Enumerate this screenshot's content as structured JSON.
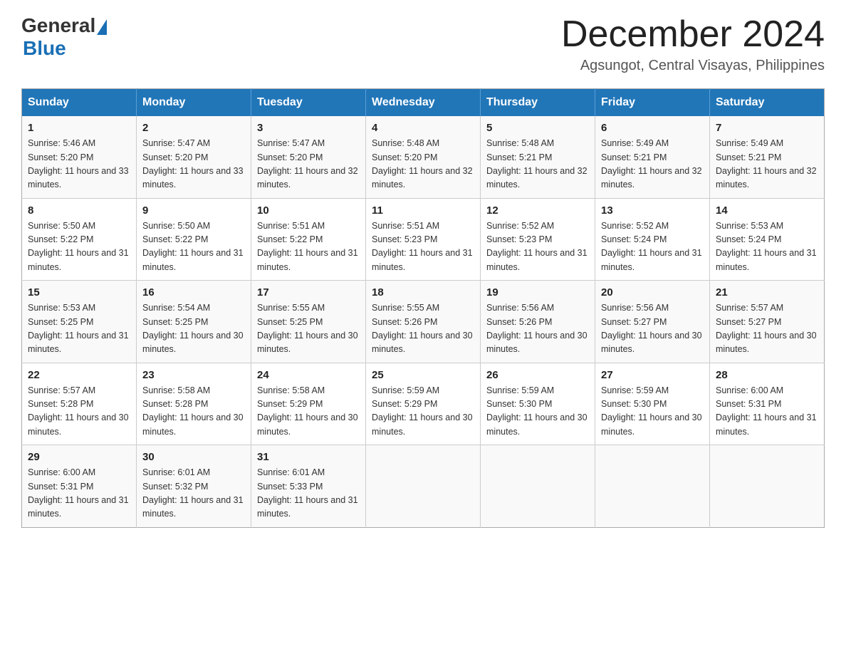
{
  "header": {
    "logo_general": "General",
    "logo_blue": "Blue",
    "month_title": "December 2024",
    "location": "Agsungot, Central Visayas, Philippines"
  },
  "columns": [
    "Sunday",
    "Monday",
    "Tuesday",
    "Wednesday",
    "Thursday",
    "Friday",
    "Saturday"
  ],
  "weeks": [
    [
      {
        "day": "1",
        "sunrise": "5:46 AM",
        "sunset": "5:20 PM",
        "daylight": "11 hours and 33 minutes."
      },
      {
        "day": "2",
        "sunrise": "5:47 AM",
        "sunset": "5:20 PM",
        "daylight": "11 hours and 33 minutes."
      },
      {
        "day": "3",
        "sunrise": "5:47 AM",
        "sunset": "5:20 PM",
        "daylight": "11 hours and 32 minutes."
      },
      {
        "day": "4",
        "sunrise": "5:48 AM",
        "sunset": "5:20 PM",
        "daylight": "11 hours and 32 minutes."
      },
      {
        "day": "5",
        "sunrise": "5:48 AM",
        "sunset": "5:21 PM",
        "daylight": "11 hours and 32 minutes."
      },
      {
        "day": "6",
        "sunrise": "5:49 AM",
        "sunset": "5:21 PM",
        "daylight": "11 hours and 32 minutes."
      },
      {
        "day": "7",
        "sunrise": "5:49 AM",
        "sunset": "5:21 PM",
        "daylight": "11 hours and 32 minutes."
      }
    ],
    [
      {
        "day": "8",
        "sunrise": "5:50 AM",
        "sunset": "5:22 PM",
        "daylight": "11 hours and 31 minutes."
      },
      {
        "day": "9",
        "sunrise": "5:50 AM",
        "sunset": "5:22 PM",
        "daylight": "11 hours and 31 minutes."
      },
      {
        "day": "10",
        "sunrise": "5:51 AM",
        "sunset": "5:22 PM",
        "daylight": "11 hours and 31 minutes."
      },
      {
        "day": "11",
        "sunrise": "5:51 AM",
        "sunset": "5:23 PM",
        "daylight": "11 hours and 31 minutes."
      },
      {
        "day": "12",
        "sunrise": "5:52 AM",
        "sunset": "5:23 PM",
        "daylight": "11 hours and 31 minutes."
      },
      {
        "day": "13",
        "sunrise": "5:52 AM",
        "sunset": "5:24 PM",
        "daylight": "11 hours and 31 minutes."
      },
      {
        "day": "14",
        "sunrise": "5:53 AM",
        "sunset": "5:24 PM",
        "daylight": "11 hours and 31 minutes."
      }
    ],
    [
      {
        "day": "15",
        "sunrise": "5:53 AM",
        "sunset": "5:25 PM",
        "daylight": "11 hours and 31 minutes."
      },
      {
        "day": "16",
        "sunrise": "5:54 AM",
        "sunset": "5:25 PM",
        "daylight": "11 hours and 30 minutes."
      },
      {
        "day": "17",
        "sunrise": "5:55 AM",
        "sunset": "5:25 PM",
        "daylight": "11 hours and 30 minutes."
      },
      {
        "day": "18",
        "sunrise": "5:55 AM",
        "sunset": "5:26 PM",
        "daylight": "11 hours and 30 minutes."
      },
      {
        "day": "19",
        "sunrise": "5:56 AM",
        "sunset": "5:26 PM",
        "daylight": "11 hours and 30 minutes."
      },
      {
        "day": "20",
        "sunrise": "5:56 AM",
        "sunset": "5:27 PM",
        "daylight": "11 hours and 30 minutes."
      },
      {
        "day": "21",
        "sunrise": "5:57 AM",
        "sunset": "5:27 PM",
        "daylight": "11 hours and 30 minutes."
      }
    ],
    [
      {
        "day": "22",
        "sunrise": "5:57 AM",
        "sunset": "5:28 PM",
        "daylight": "11 hours and 30 minutes."
      },
      {
        "day": "23",
        "sunrise": "5:58 AM",
        "sunset": "5:28 PM",
        "daylight": "11 hours and 30 minutes."
      },
      {
        "day": "24",
        "sunrise": "5:58 AM",
        "sunset": "5:29 PM",
        "daylight": "11 hours and 30 minutes."
      },
      {
        "day": "25",
        "sunrise": "5:59 AM",
        "sunset": "5:29 PM",
        "daylight": "11 hours and 30 minutes."
      },
      {
        "day": "26",
        "sunrise": "5:59 AM",
        "sunset": "5:30 PM",
        "daylight": "11 hours and 30 minutes."
      },
      {
        "day": "27",
        "sunrise": "5:59 AM",
        "sunset": "5:30 PM",
        "daylight": "11 hours and 30 minutes."
      },
      {
        "day": "28",
        "sunrise": "6:00 AM",
        "sunset": "5:31 PM",
        "daylight": "11 hours and 31 minutes."
      }
    ],
    [
      {
        "day": "29",
        "sunrise": "6:00 AM",
        "sunset": "5:31 PM",
        "daylight": "11 hours and 31 minutes."
      },
      {
        "day": "30",
        "sunrise": "6:01 AM",
        "sunset": "5:32 PM",
        "daylight": "11 hours and 31 minutes."
      },
      {
        "day": "31",
        "sunrise": "6:01 AM",
        "sunset": "5:33 PM",
        "daylight": "11 hours and 31 minutes."
      },
      null,
      null,
      null,
      null
    ]
  ]
}
